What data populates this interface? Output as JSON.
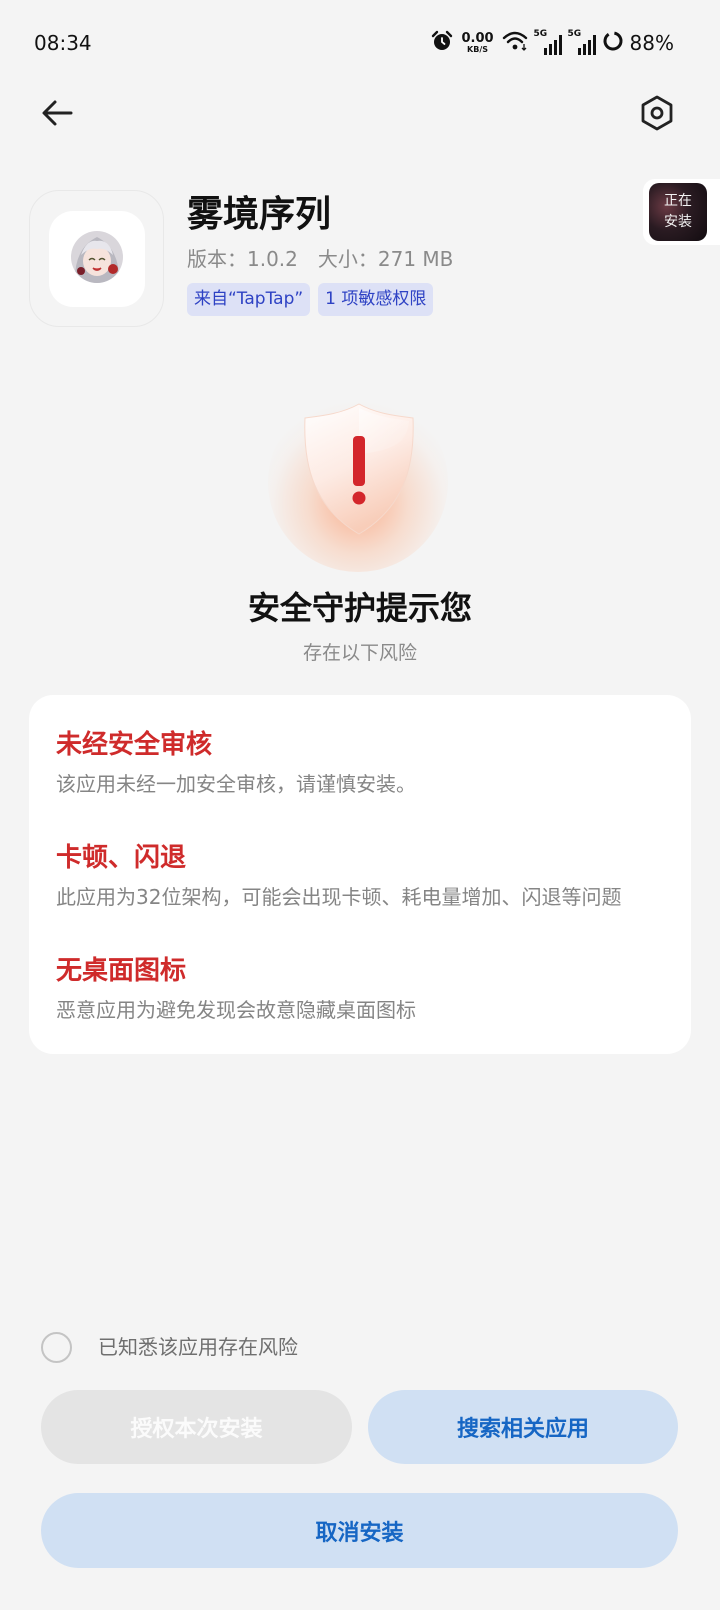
{
  "status_bar": {
    "time": "08:34",
    "net_speed_value": "0.00",
    "net_speed_unit": "KB/S",
    "signal1_label": "5G",
    "signal2_label": "5G",
    "battery": "88%",
    "icons": [
      "alarm-icon",
      "wifi-icon",
      "signal-icon",
      "signal-icon",
      "battery-ring-icon"
    ]
  },
  "header": {
    "back_icon": "arrow-left-icon",
    "settings_icon": "hexagon-settings-icon"
  },
  "app": {
    "name": "雾境序列",
    "version": "版本：1.0.2",
    "size": "大小：271 MB",
    "badges": [
      "来自“TapTap”",
      "1 项敏感权限"
    ]
  },
  "floating_status": {
    "line1": "正在",
    "line2": "安装"
  },
  "warning": {
    "icon": "shield-exclamation-icon",
    "title": "安全守护提示您",
    "subtitle": "存在以下风险"
  },
  "risks": [
    {
      "title": "未经安全审核",
      "desc": "该应用未经一加安全审核，请谨慎安装。"
    },
    {
      "title": "卡顿、闪退",
      "desc": "此应用为32位架构，可能会出现卡顿、耗电量增加、闪退等问题"
    },
    {
      "title": "无桌面图标",
      "desc": "恶意应用为避免发现会故意隐藏桌面图标"
    }
  ],
  "acknowledge": {
    "label": "已知悉该应用存在风险",
    "checked": false
  },
  "buttons": {
    "authorize": "授权本次安装",
    "search": "搜索相关应用",
    "cancel": "取消安装"
  },
  "colors": {
    "background": "#f4f4f4",
    "risk_red": "#cf2b2b",
    "badge_bg": "#dde1f6",
    "badge_text": "#2e42c4",
    "primary_btn_bg": "#d0e0f3",
    "primary_btn_text": "#1666c4",
    "disabled_btn_bg": "#e4e4e4"
  }
}
